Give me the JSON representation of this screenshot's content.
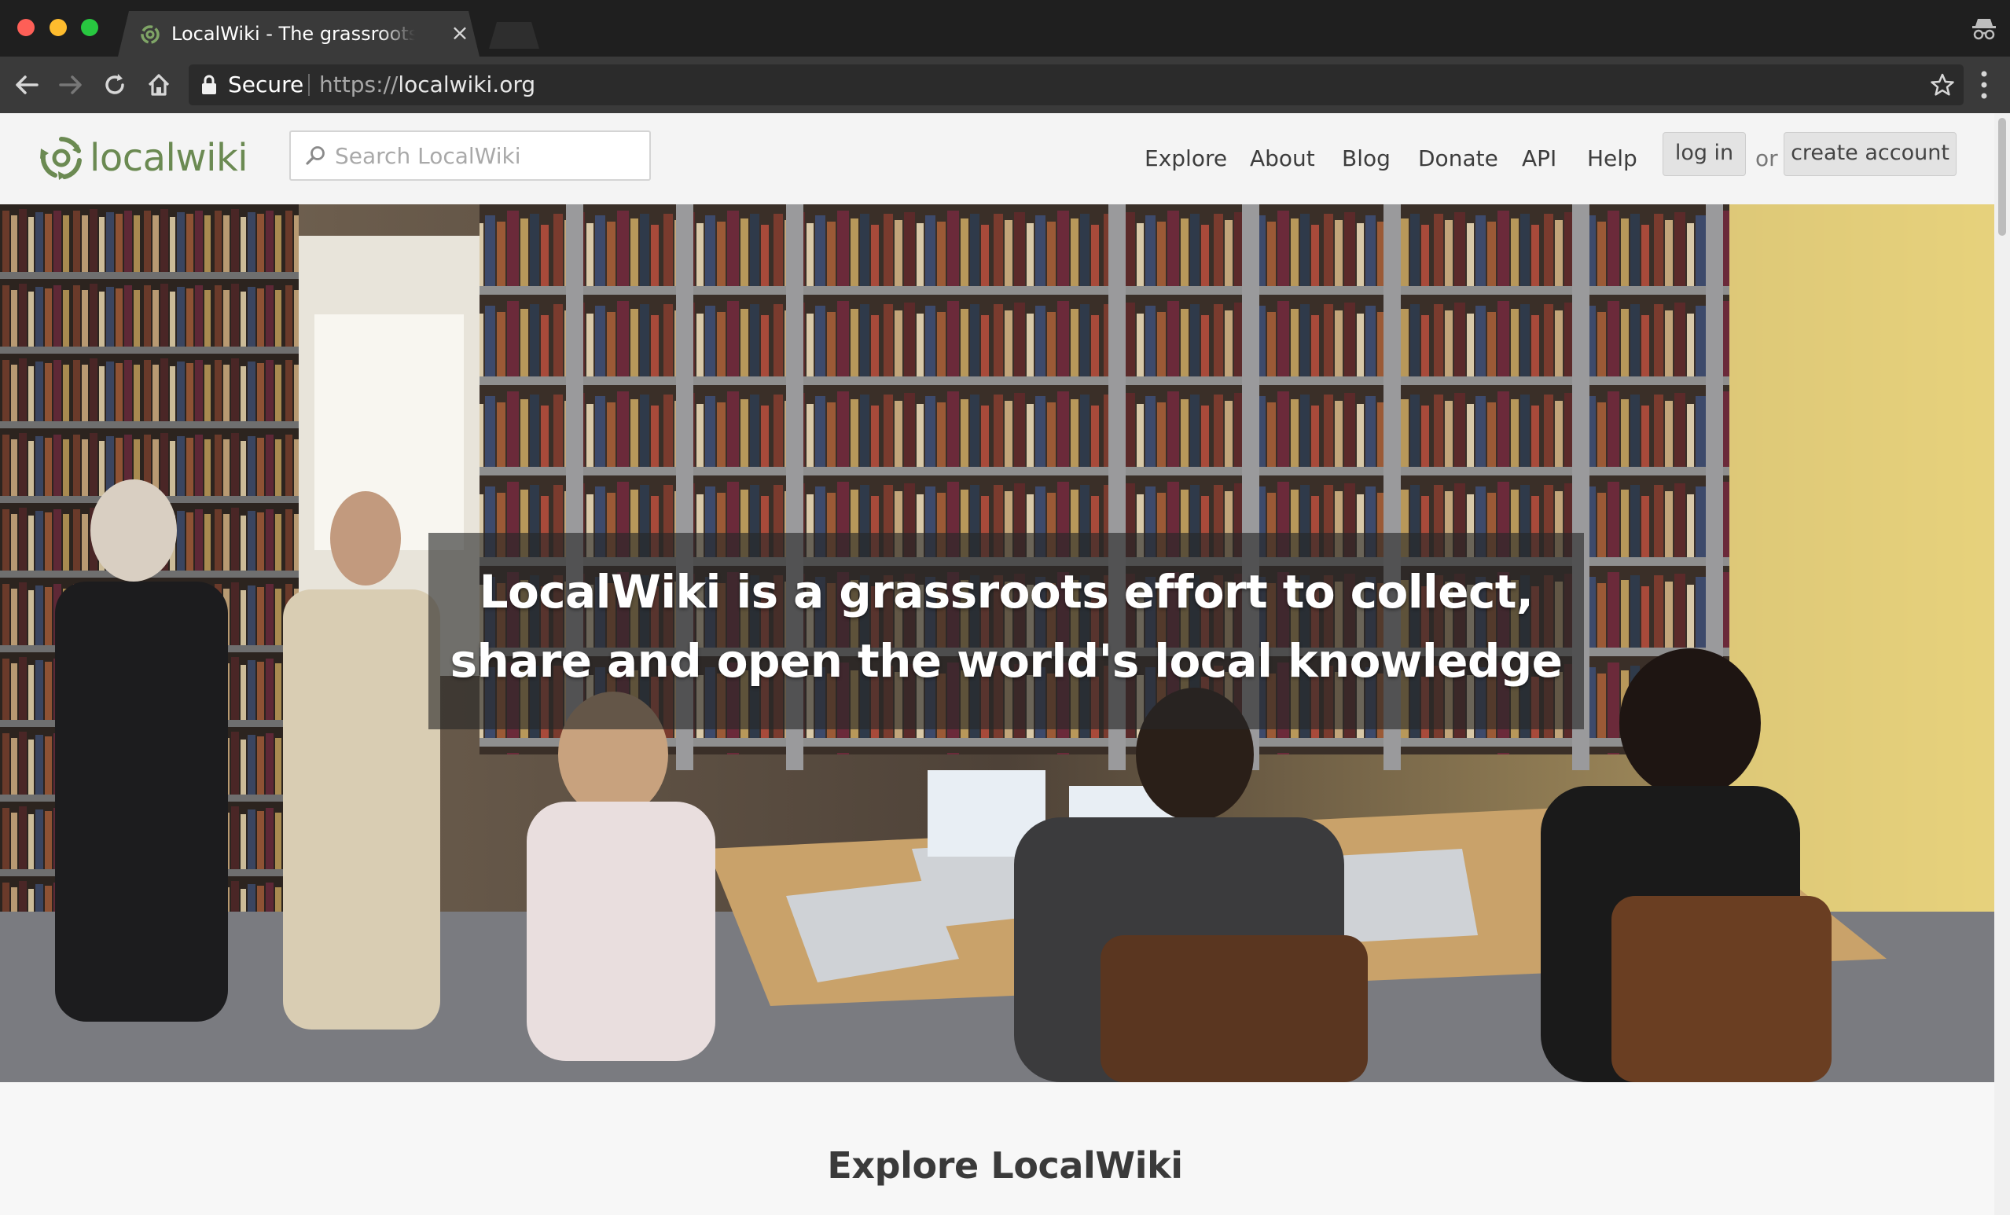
{
  "browser": {
    "tab_title": "LocalWiki - The grassroots effort to collect, share and open the world's local knowledge",
    "tab_close_glyph": "×",
    "secure_label": "Secure",
    "url_scheme": "https://",
    "url_host": "localwiki.org",
    "icons": {
      "back": "arrow-left-icon",
      "forward": "arrow-right-icon",
      "reload": "reload-icon",
      "home": "home-icon",
      "lock": "lock-icon",
      "bookmark": "star-icon",
      "menu": "kebab-menu-icon",
      "incognito": "incognito-icon"
    }
  },
  "site": {
    "logo_text": "localwiki",
    "search_placeholder": "Search LocalWiki",
    "nav": [
      "Explore",
      "About",
      "Blog",
      "Donate",
      "API",
      "Help"
    ],
    "login_label": "log in",
    "or_text": "or",
    "create_account_label": "create account",
    "brand_color": "#6b8a52"
  },
  "hero": {
    "line1": "LocalWiki is a grassroots effort to collect,",
    "line2": "share and open the world's local knowledge"
  },
  "explore": {
    "title": "Explore LocalWiki"
  }
}
